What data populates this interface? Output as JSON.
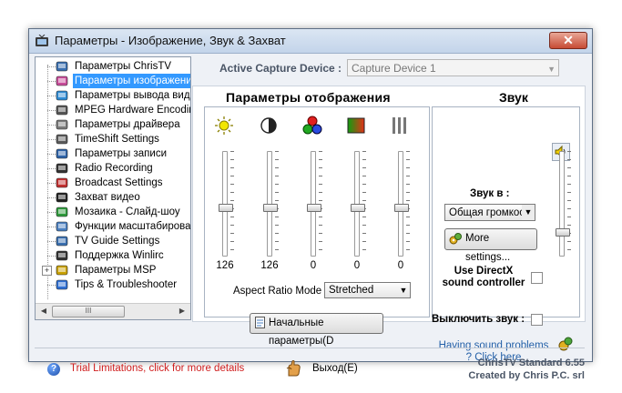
{
  "window": {
    "title": "Параметры - Изображение, Звук & Захват",
    "close_glyph": "✕"
  },
  "tree": {
    "items": [
      {
        "label": "Параметры ChrisTV",
        "icon": "tv-icon",
        "selected": false
      },
      {
        "label": "Параметры изображени",
        "icon": "image-settings-icon",
        "selected": true
      },
      {
        "label": "Параметры вывода виде",
        "icon": "globe-icon",
        "selected": false
      },
      {
        "label": "MPEG Hardware Encoding",
        "icon": "mpeg-icon",
        "selected": false
      },
      {
        "label": "Параметры драйвера",
        "icon": "driver-icon",
        "selected": false
      },
      {
        "label": "TimeShift Settings",
        "icon": "clock-icon",
        "selected": false
      },
      {
        "label": "Параметры записи",
        "icon": "record-icon",
        "selected": false
      },
      {
        "label": "Radio Recording",
        "icon": "microphone-icon",
        "selected": false
      },
      {
        "label": "Broadcast Settings",
        "icon": "broadcast-icon",
        "selected": false
      },
      {
        "label": "Захват видео",
        "icon": "camera-icon",
        "selected": false
      },
      {
        "label": "Мозаика - Слайд-шоу",
        "icon": "mosaic-icon",
        "selected": false
      },
      {
        "label": "Функции масштабирова",
        "icon": "zoom-icon",
        "selected": false
      },
      {
        "label": "TV Guide Settings",
        "icon": "tv-guide-icon",
        "selected": false
      },
      {
        "label": "Поддержка Winlirc",
        "icon": "remote-icon",
        "selected": false
      },
      {
        "label": "Параметры MSP",
        "icon": "msp-icon",
        "selected": false
      },
      {
        "label": "Tips & Troubleshooter",
        "icon": "help-icon",
        "selected": false
      }
    ],
    "scroll_thumb_grip": "III"
  },
  "capture": {
    "label": "Active Capture Device :",
    "value": "Capture Device 1"
  },
  "display": {
    "title": "Параметры отображения",
    "sliders": [
      {
        "name": "brightness",
        "icon": "sun-icon",
        "value": "126",
        "level": 0.45
      },
      {
        "name": "contrast",
        "icon": "contrast-icon",
        "value": "126",
        "level": 0.45
      },
      {
        "name": "saturation",
        "icon": "color-circles-icon",
        "value": "0",
        "level": 0.45
      },
      {
        "name": "hue",
        "icon": "hue-gradient-icon",
        "value": "0",
        "level": 0.45
      },
      {
        "name": "sharpness",
        "icon": "sharpness-bars-icon",
        "value": "0",
        "level": 0.45
      }
    ],
    "aspect_label": "Aspect Ratio Mode :",
    "aspect_value": "Stretched",
    "defaults_button": "Начальные параметры(D"
  },
  "sound": {
    "title": "Звук",
    "input_label": "Звук в :",
    "input_value": "Общая громкос",
    "more_button": "More settings...",
    "directx_label": "Use DirectX sound controller",
    "mute_label": "Выключить звук :",
    "help_link": "Having sound problems ? Click here",
    "volume_level": 0.2
  },
  "footer": {
    "trial_text": "Trial Limitations, click for more details",
    "exit_button": "Выход(E)",
    "version_line1": "ChrisTV Standard 6.55",
    "version_line2": "Created by Chris P.C. srl"
  },
  "colors": {
    "selection": "#3399ff",
    "trial_text": "#d01f1f",
    "link": "#2460a8",
    "close_button": "#c74b34"
  }
}
